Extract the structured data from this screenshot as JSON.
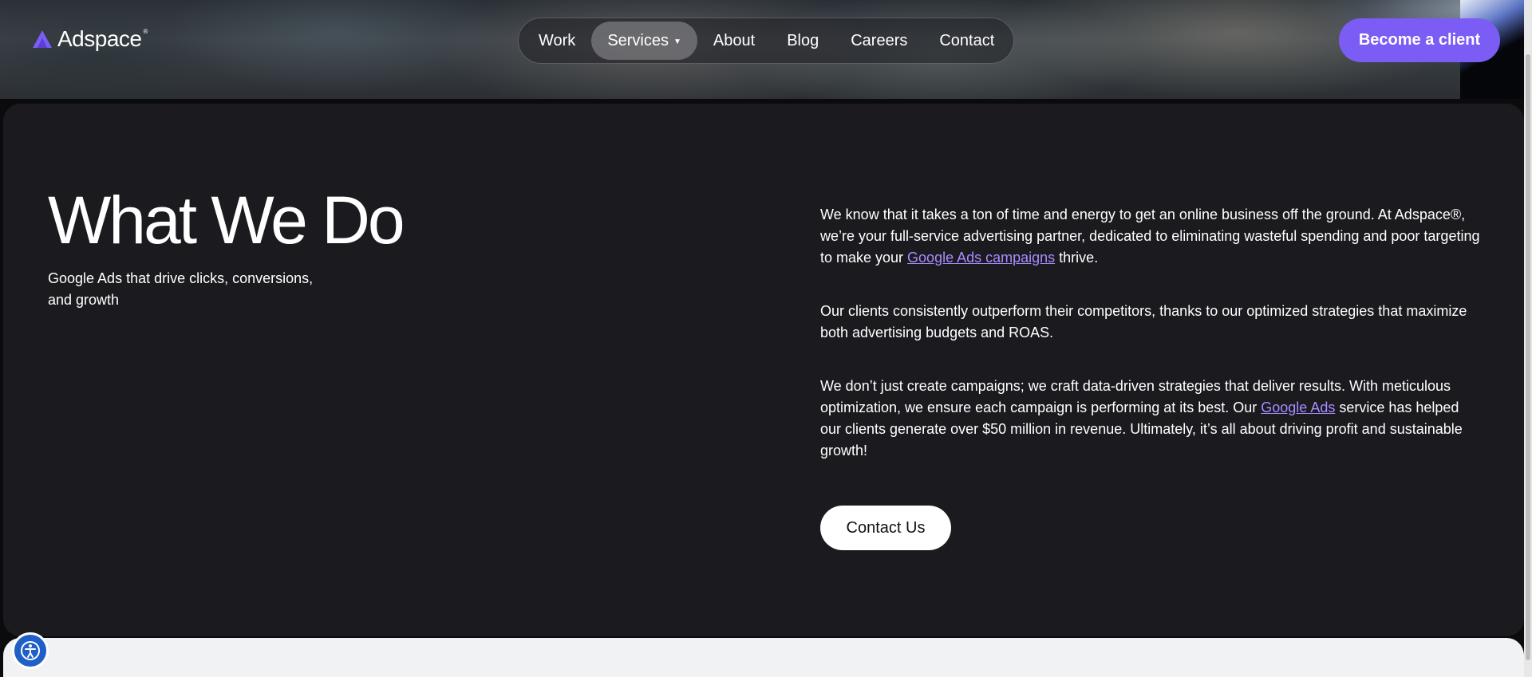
{
  "header": {
    "logo_text": "Adspace",
    "logo_reg": "®",
    "nav": [
      {
        "label": "Work"
      },
      {
        "label": "Services",
        "active": true,
        "has_dropdown": true
      },
      {
        "label": "About"
      },
      {
        "label": "Blog"
      },
      {
        "label": "Careers"
      },
      {
        "label": "Contact"
      }
    ],
    "cta_label": "Become a client"
  },
  "main": {
    "title": "What We Do",
    "subtitle": "Google Ads that drive clicks, conversions, and growth",
    "paragraph1": {
      "before": "We know that it takes a ton of time and energy to get an online business off the ground. At Adspace®, we’re your full-service advertising partner, dedicated to eliminating wasteful spending and poor targeting to make your ",
      "link": "Google Ads campaigns",
      "after": " thrive."
    },
    "paragraph2": "Our clients consistently outperform their competitors, thanks to our optimized strategies that maximize both advertising budgets and ROAS.",
    "paragraph3": {
      "before": "We don’t just create campaigns; we craft data-driven strategies that deliver results. With meticulous optimization, we ensure each campaign is performing at its best. Our ",
      "link": "Google Ads",
      "after": " service has helped our clients generate over $50 million in revenue. Ultimately, it’s all about driving profit and sustainable growth!"
    },
    "contact_button": "Contact Us"
  },
  "icons": {
    "logo": "adspace-logo-icon",
    "caret": "chevron-down-icon",
    "accessibility": "accessibility-icon"
  },
  "colors": {
    "accent": "#7b5cf5",
    "link": "#a98bff",
    "card_bg": "#1b1b1f",
    "accessibility_badge": "#1f5fc7"
  }
}
